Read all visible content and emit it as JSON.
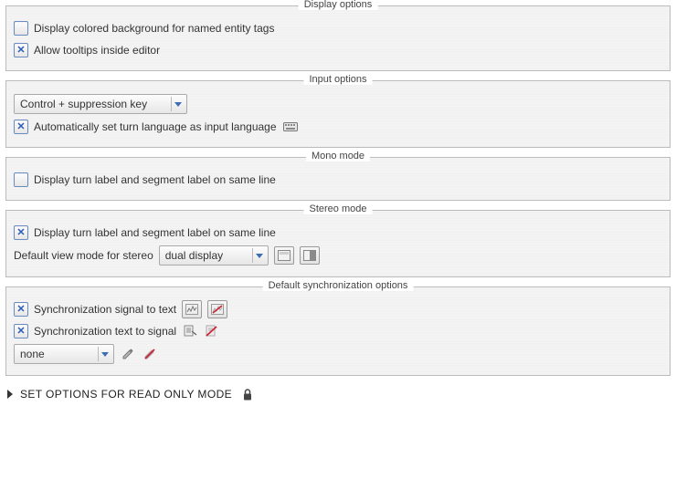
{
  "groups": {
    "display": {
      "title": "Display options",
      "coloredBg": "Display colored background for named entity tags",
      "tooltips": "Allow tooltips inside editor"
    },
    "input": {
      "title": "Input options",
      "combo": "Control + suppression key",
      "autoLang": "Automatically set turn language as input language"
    },
    "mono": {
      "title": "Mono mode",
      "sameLine": "Display turn label and segment label on same line"
    },
    "stereo": {
      "title": "Stereo mode",
      "sameLine": "Display turn label and segment label on same line",
      "defaultViewLabel": "Default view mode for stereo",
      "defaultViewValue": "dual display"
    },
    "sync": {
      "title": "Default synchronization options",
      "sigToText": "Synchronization signal to text",
      "textToSig": "Synchronization text to signal",
      "combo": "none"
    }
  },
  "expander": {
    "label": "SET OPTIONS FOR READ ONLY MODE"
  }
}
